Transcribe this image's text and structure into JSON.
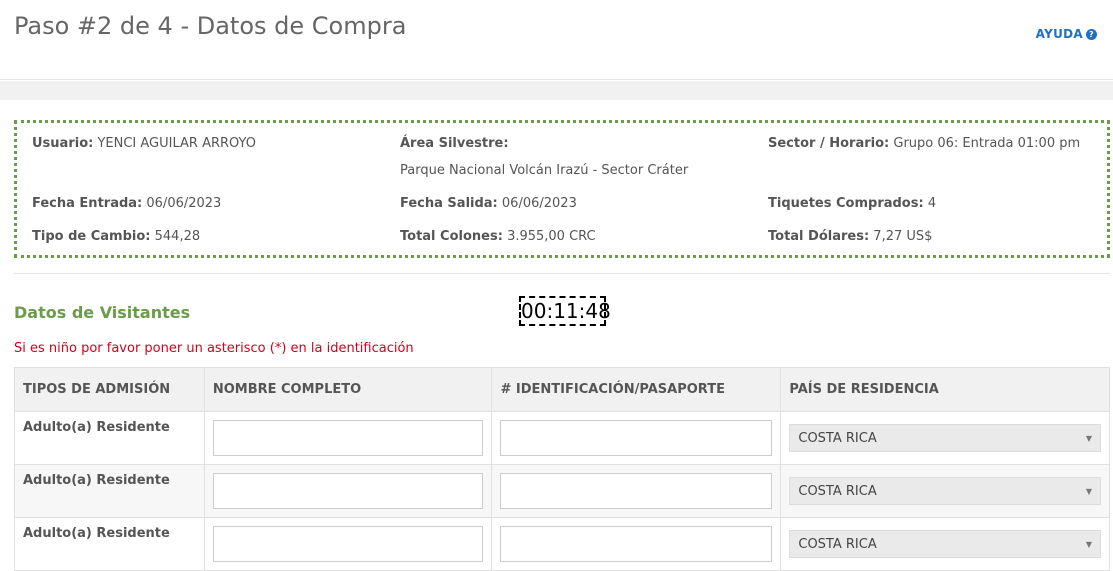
{
  "header": {
    "title": "Paso #2 de 4 - Datos de Compra",
    "help_label": "AYUDA",
    "help_icon": "question-circle-icon"
  },
  "summary": {
    "usuario_label": "Usuario:",
    "usuario_value": "YENCI AGUILAR ARROYO",
    "area_label": "Área Silvestre:",
    "area_value": "Parque Nacional Volcán Irazú - Sector Cráter",
    "sector_label": "Sector / Horario:",
    "sector_value": "Grupo 06: Entrada 01:00 pm",
    "fecha_entrada_label": "Fecha Entrada:",
    "fecha_entrada_value": "06/06/2023",
    "fecha_salida_label": "Fecha Salida:",
    "fecha_salida_value": "06/06/2023",
    "tiquetes_label": "Tiquetes Comprados:",
    "tiquetes_value": "4",
    "cambio_label": "Tipo de Cambio:",
    "cambio_value": "544,28",
    "colones_label": "Total Colones:",
    "colones_value": "3.955,00 CRC",
    "dolares_label": "Total Dólares:",
    "dolares_value": "7,27 US$"
  },
  "visitors": {
    "title": "Datos de Visitantes",
    "timer": "00:11:48",
    "note": "Si es niño por favor poner un asterisco (*) en la identificación",
    "columns": [
      "TIPOS DE ADMISIÓN",
      "NOMBRE COMPLETO",
      "# IDENTIFICACIÓN/PASAPORTE",
      "PAÍS DE RESIDENCIA"
    ],
    "rows": [
      {
        "type": "Adulto(a) Residente",
        "name": "",
        "id": "",
        "country": "COSTA RICA"
      },
      {
        "type": "Adulto(a) Residente",
        "name": "",
        "id": "",
        "country": "COSTA RICA"
      },
      {
        "type": "Adulto(a) Residente",
        "name": "",
        "id": "",
        "country": "COSTA RICA"
      }
    ]
  },
  "colors": {
    "accent_green": "#6a9c4a",
    "link_blue": "#1f70c1",
    "note_red": "#d0021b"
  }
}
